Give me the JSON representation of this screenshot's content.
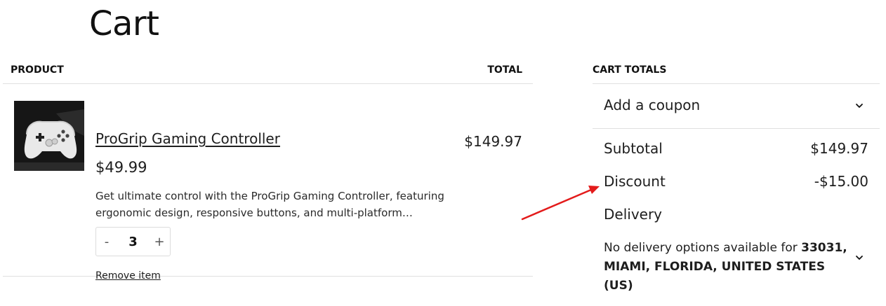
{
  "page": {
    "title": "Cart"
  },
  "products_table": {
    "headers": {
      "product": "PRODUCT",
      "total": "TOTAL"
    },
    "items": [
      {
        "name": "ProGrip Gaming Controller",
        "price": "$49.99",
        "description": "Get ultimate control with the ProGrip Gaming Controller, featuring ergonomic design, responsive buttons, and multi-platform…",
        "quantity": "3",
        "qty_minus": "-",
        "qty_plus": "+",
        "remove_label": "Remove item",
        "line_total": "$149.97",
        "image_icon": "game-controller"
      }
    ]
  },
  "totals": {
    "heading": "CART TOTALS",
    "coupon_label": "Add a coupon",
    "subtotal_label": "Subtotal",
    "subtotal_value": "$149.97",
    "discount_label": "Discount",
    "discount_value": "-$15.00",
    "delivery_label": "Delivery",
    "delivery_note_prefix": "No delivery options available for ",
    "delivery_note_location": "33031, MIAMI, FLORIDA, UNITED STATES (US)"
  },
  "colors": {
    "annotation_arrow": "#e31b1b",
    "text": "#1e1e1e",
    "divider": "#e0e0e0"
  }
}
